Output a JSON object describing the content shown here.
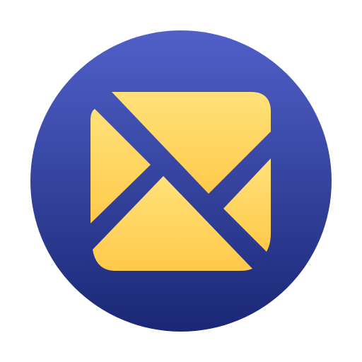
{
  "icon": {
    "name": "mail-icon",
    "style": "circular badge with diagonal-cut envelope",
    "colors": {
      "badge_top": "#5160C9",
      "badge_bottom": "#1A2775",
      "envelope_top": "#FFE27A",
      "envelope_bottom": "#FFC94A",
      "page_background": "#FFFFFF"
    }
  }
}
